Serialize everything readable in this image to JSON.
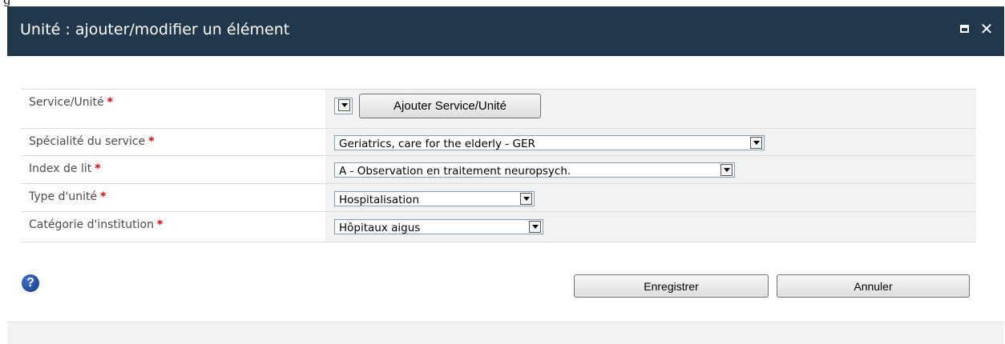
{
  "top_strip": {
    "text": "g"
  },
  "window": {
    "title": "Unité : ajouter/modifier un élément",
    "maximize_icon": "maximize-icon",
    "close_glyph": "✕",
    "colors": {
      "titlebar": "#21374c",
      "required": "#e00000"
    }
  },
  "form": {
    "required_marker": "*",
    "fields": [
      {
        "label": "Service/Unité",
        "value": "",
        "button_label": "Ajouter Service/Unité"
      },
      {
        "label": "Spécialité du service",
        "value": "Geriatrics, care for the elderly - GER"
      },
      {
        "label": "Index de lit",
        "value": "A - Observation en traitement neuropsych."
      },
      {
        "label": "Type d'unité",
        "value": "Hospitalisation"
      },
      {
        "label": "Catégorie d'institution",
        "value": "Hôpitaux aigus"
      }
    ]
  },
  "footer": {
    "help_icon": "help-icon",
    "help_glyph": "?",
    "save_label": "Enregistrer",
    "cancel_label": "Annuler"
  }
}
